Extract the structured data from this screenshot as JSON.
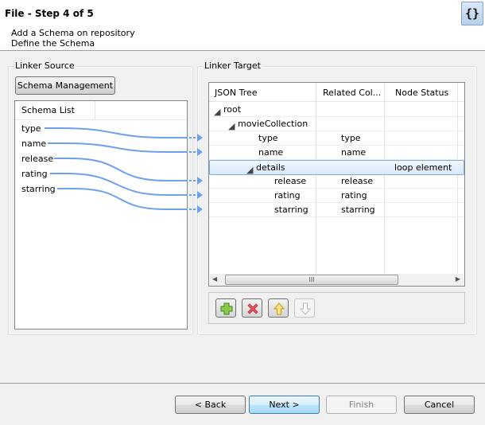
{
  "header": {
    "title": "File - Step 4 of 5",
    "subtitle_1": "Add a Schema on repository",
    "subtitle_2": "Define the Schema",
    "icon": "json-file-icon",
    "icon_glyph": "{}"
  },
  "linker_source": {
    "legend": "Linker Source",
    "schema_management_label": "Schema Management",
    "list_header": "Schema List",
    "items": [
      "type",
      "name",
      "release",
      "rating",
      "starring"
    ]
  },
  "linker_target": {
    "legend": "Linker Target",
    "columns": [
      "JSON Tree",
      "Related Col...",
      "Node Status"
    ],
    "rows": [
      {
        "node": "root",
        "related": "",
        "status": "",
        "expandable": true,
        "level": 0
      },
      {
        "node": "movieCollection",
        "related": "",
        "status": "",
        "expandable": true,
        "level": 1
      },
      {
        "node": "type",
        "related": "type",
        "status": "",
        "expandable": false,
        "level": 2
      },
      {
        "node": "name",
        "related": "name",
        "status": "",
        "expandable": false,
        "level": 2
      },
      {
        "node": "details",
        "related": "",
        "status": "loop element",
        "expandable": true,
        "level": 2,
        "selected": true
      },
      {
        "node": "release",
        "related": "release",
        "status": "",
        "expandable": false,
        "level": 3
      },
      {
        "node": "rating",
        "related": "rating",
        "status": "",
        "expandable": false,
        "level": 3
      },
      {
        "node": "starring",
        "related": "starring",
        "status": "",
        "expandable": false,
        "level": 3
      }
    ],
    "scrollbar_grip": "III",
    "toolbar": [
      {
        "name": "add-node-button",
        "icon": "plus-icon",
        "enabled": true
      },
      {
        "name": "remove-node-button",
        "icon": "red-x-icon",
        "enabled": true
      },
      {
        "name": "move-up-button",
        "icon": "arrow-up-icon",
        "enabled": true
      },
      {
        "name": "move-down-button",
        "icon": "arrow-down-icon",
        "enabled": false
      }
    ]
  },
  "links": [
    {
      "source": "type",
      "target": "type"
    },
    {
      "source": "name",
      "target": "name"
    },
    {
      "source": "release",
      "target": "release"
    },
    {
      "source": "rating",
      "target": "rating"
    },
    {
      "source": "starring",
      "target": "starring"
    }
  ],
  "colors": {
    "link_line": "#6ea0f0",
    "selection_border": "#84acdd",
    "primary_button_border": "#3c7fb1"
  },
  "footer": {
    "back_label": "< Back",
    "next_label": "Next >",
    "finish_label": "Finish",
    "cancel_label": "Cancel",
    "finish_enabled": false
  }
}
